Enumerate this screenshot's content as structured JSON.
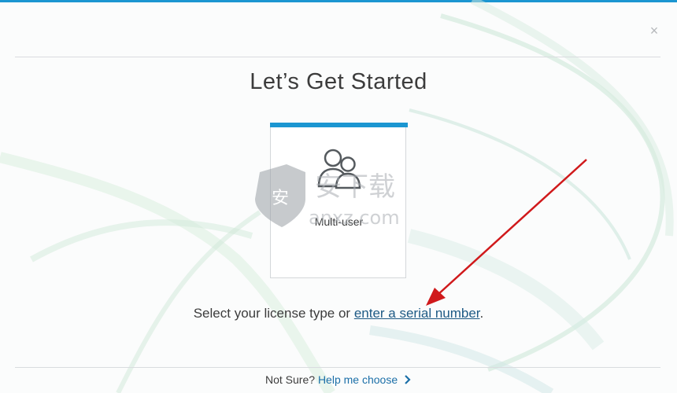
{
  "dialog": {
    "title": "Let’s Get Started",
    "close_glyph": "×"
  },
  "license_option": {
    "label": "Multi-user",
    "icon": "multi-user-icon",
    "accent_color": "#1b96d1"
  },
  "prompt": {
    "text_before": "Select your license type or ",
    "link_text": "enter a serial number",
    "text_after": "."
  },
  "footer": {
    "question": "Not Sure?",
    "help_link": "Help me choose"
  },
  "watermark": {
    "text_top": "安下载",
    "text_bottom": "anxz.com",
    "badge_glyph": "安"
  },
  "colors": {
    "accent": "#1b96d1",
    "link": "#1e5a85",
    "annotation_arrow": "#d0191b"
  }
}
